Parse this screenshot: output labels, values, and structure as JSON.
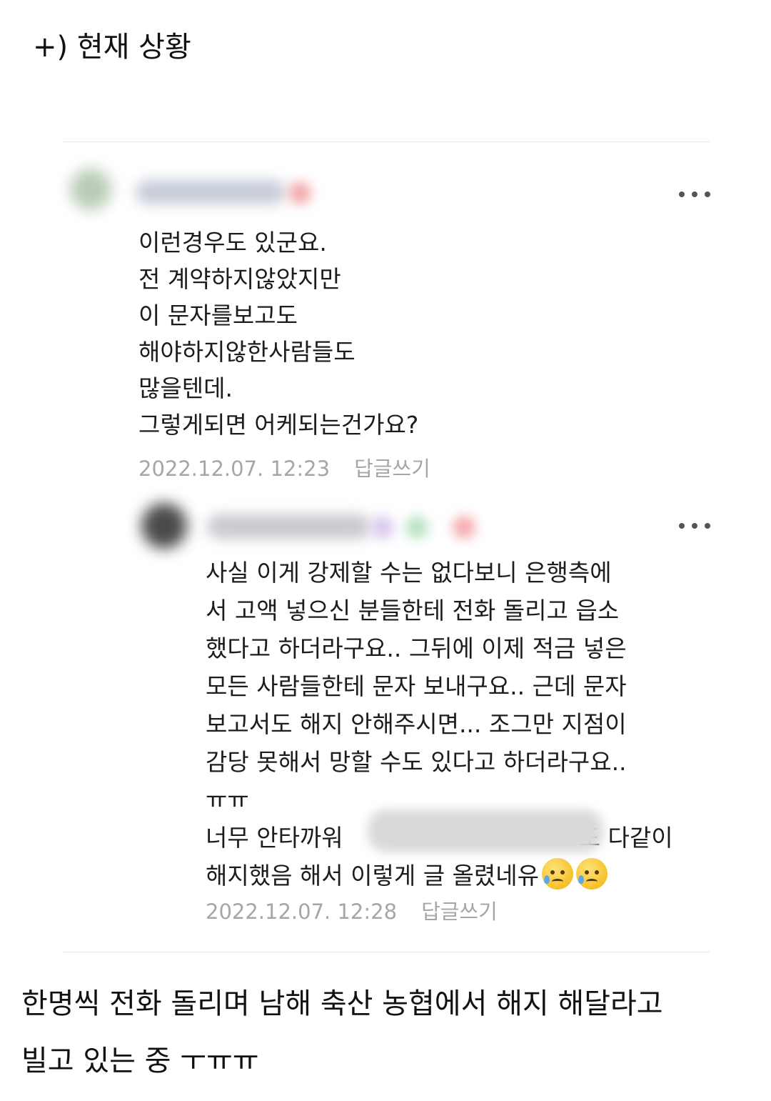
{
  "header": {
    "title": "+) 현재 상황"
  },
  "comment1": {
    "text": "이런경우도 있군요.\n전 계약하지않았지만\n이 문자를보고도\n해야하지않한사람들도\n많을텐데.\n그렇게되면 어케되는건가요?",
    "timestamp": "2022.12.07. 12:23",
    "reply_label": "답글쓰기",
    "avatar_color": "#b9ccb6",
    "name_blur_color": "#c6ccd8",
    "badge_color": "#f4a9ae"
  },
  "comment2": {
    "lines": [
      "사실 이게 강제할 수는 없다보니 은행측에",
      "서 고액 넣으신 분들한테 전화 돌리고 읍소",
      "했다고 하더라구요.. 그뒤에 이제 적금 넣은",
      "모든 사람들한테 문자 보내구요.. 근데 문자",
      "보고서도 해지 안해주시면... 조그만 지점이",
      "감당 못해서 망할 수도 있다고 하더라구요..",
      "ㅠㅠ"
    ],
    "line8_start": "너무 안타까워",
    "line8_end": "도 다같이",
    "line9": "해지했음 해서 이렇게 글 올렸네유",
    "emoji": "sad-face-with-sweat",
    "timestamp": "2022.12.07. 12:28",
    "reply_label": "답글쓰기",
    "avatar_color": "#4a4a4a",
    "name_blur_color": "#c9c9cf",
    "badge_color_1": "#d9c8ee",
    "badge_color_2": "#b7e2c2",
    "badge_color_3": "#f4a9ae"
  },
  "caption": {
    "line1": "한명씩 전화 돌리며 남해 축산 농협에서 해지 해달라고",
    "line2": "빌고 있는 중 ㅜㅠㅠ"
  }
}
